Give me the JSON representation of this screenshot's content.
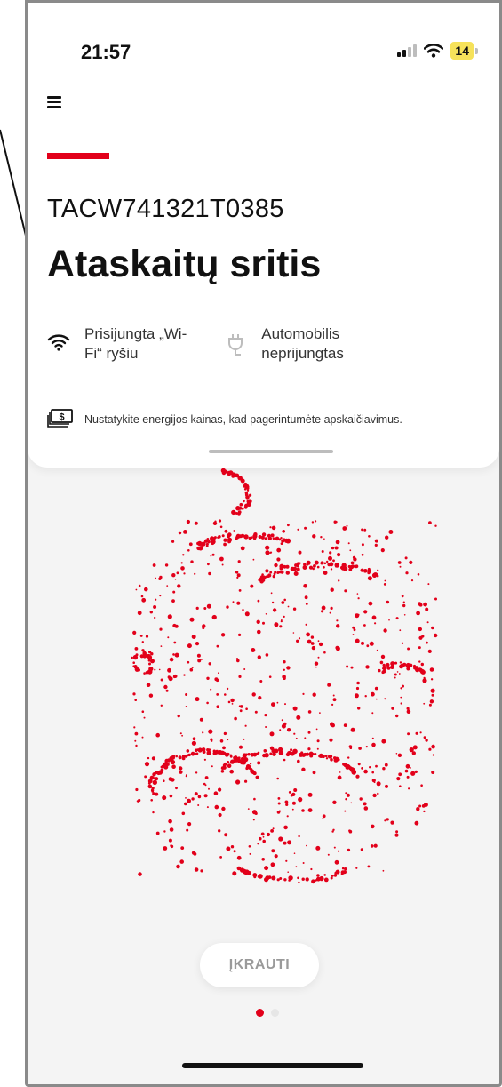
{
  "status_bar": {
    "time": "21:57",
    "battery": "14"
  },
  "header": {
    "device_id": "TACW741321T0385",
    "title": "Ataskaitų sritis"
  },
  "connection": {
    "wifi_line1": "Prisijungta „Wi-",
    "wifi_line2": "Fi“ ryšiu",
    "car_line1": "Automobilis",
    "car_line2": "neprijungtas"
  },
  "price_hint": "Nustatykite energijos kainas, kad pagerintumėte apskaičiavimus.",
  "charge_button": "ĮKRAUTI",
  "pager": {
    "pages": 2,
    "active": 0
  },
  "colors": {
    "accent": "#e2001a",
    "inactive_dot": "#e6e6e6"
  },
  "icons": [
    "menu-icon",
    "wifi-icon",
    "plug-icon",
    "money-icon",
    "signal-icon",
    "wifi-status-icon",
    "battery-icon"
  ]
}
